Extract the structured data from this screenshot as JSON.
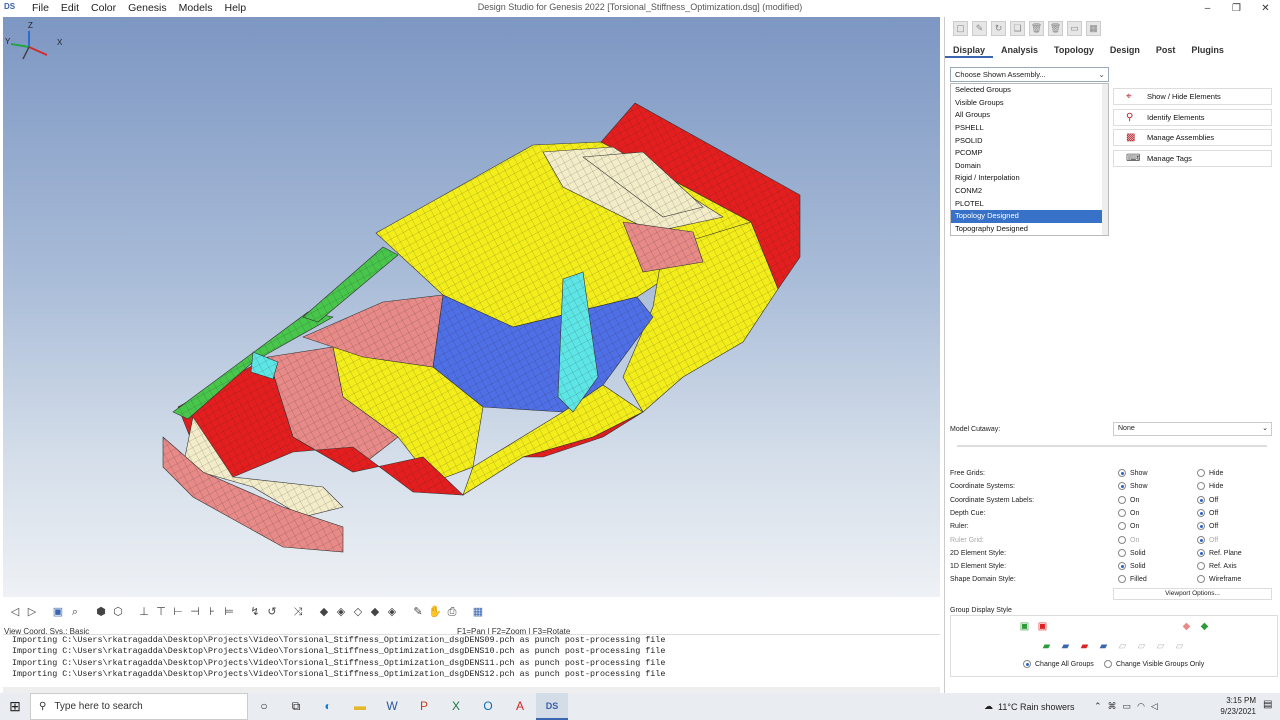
{
  "window": {
    "app_icon": "DS",
    "title": "Design Studio for Genesis 2022 [Torsional_Stiffness_Optimization.dsg] (modified)",
    "controls": [
      "–",
      "❐",
      "✕"
    ]
  },
  "menu": [
    "File",
    "Edit",
    "Color",
    "Genesis",
    "Models",
    "Help"
  ],
  "viewport": {
    "triad_labels": {
      "z": "Z",
      "y": "Y",
      "x": "X"
    },
    "model_colors": [
      "#e41e1e",
      "#f3ee1b",
      "#4f6fe6",
      "#e78a88",
      "#47c64b",
      "#5ee6e6",
      "#f3ecc9"
    ]
  },
  "status": {
    "coord_sys": "View Coord. Sys.: Basic",
    "mouse_hint": "F1=Pan | F2=Zoom | F3=Rotate"
  },
  "console": {
    "lines": [
      "Importing C:\\Users\\rkatragadda\\Desktop\\Projects\\Video\\Torsional_Stiffness_Optimization_dsgDENS09.pch as punch post-processing file",
      "Importing C:\\Users\\rkatragadda\\Desktop\\Projects\\Video\\Torsional_Stiffness_Optimization_dsgDENS10.pch as punch post-processing file",
      "Importing C:\\Users\\rkatragadda\\Desktop\\Projects\\Video\\Torsional_Stiffness_Optimization_dsgDENS11.pch as punch post-processing file",
      "Importing C:\\Users\\rkatragadda\\Desktop\\Projects\\Video\\Torsional_Stiffness_Optimization_dsgDENS12.pch as punch post-processing file"
    ]
  },
  "panel": {
    "tabs": [
      "Display",
      "Analysis",
      "Topology",
      "Design",
      "Post",
      "Plugins"
    ],
    "active_tab": "Display",
    "assembly_select": "Choose Shown Assembly...",
    "assembly_options": [
      "Selected Groups",
      "Visible Groups",
      "All Groups",
      "PSHELL",
      "PSOLID",
      "PCOMP",
      "Domain",
      "Rigid / Interpolation",
      "CONM2",
      "PLOTEL",
      "Topology Designed",
      "Topography Designed"
    ],
    "assembly_highlighted": "Topology Designed",
    "actions": [
      "Show / Hide Elements",
      "Identify Elements",
      "Manage Assemblies",
      "Manage Tags"
    ],
    "model_cutaway_label": "Model Cutaway:",
    "model_cutaway_value": "None",
    "settings": [
      {
        "label": "Free Grids:",
        "a": "Show",
        "b": "Hide",
        "selected": "a",
        "enabled": true
      },
      {
        "label": "Coordinate Systems:",
        "a": "Show",
        "b": "Hide",
        "selected": "a",
        "enabled": true
      },
      {
        "label": "Coordinate System Labels:",
        "a": "On",
        "b": "Off",
        "selected": "b",
        "enabled": true
      },
      {
        "label": "Depth Cue:",
        "a": "On",
        "b": "Off",
        "selected": "b",
        "enabled": true
      },
      {
        "label": "Ruler:",
        "a": "On",
        "b": "Off",
        "selected": "b",
        "enabled": true
      },
      {
        "label": "Ruler Grid:",
        "a": "On",
        "b": "Off",
        "selected": "b",
        "enabled": false
      },
      {
        "label": "2D Element Style:",
        "a": "Solid",
        "b": "Ref. Plane",
        "selected": "b",
        "enabled": true
      },
      {
        "label": "1D Element Style:",
        "a": "Solid",
        "b": "Ref. Axis",
        "selected": "a",
        "enabled": true
      },
      {
        "label": "Shape Domain Style:",
        "a": "Filled",
        "b": "Wireframe",
        "selected": "none",
        "enabled": true
      }
    ],
    "viewport_options": "Viewport Options...",
    "group_display_style": "Group Display Style",
    "change_all": "Change All Groups",
    "change_visible": "Change Visible Groups Only"
  },
  "taskbar": {
    "search_placeholder": "Type here to search",
    "weather": "11°C  Rain showers",
    "time": "3:15 PM",
    "date": "9/23/2021"
  }
}
